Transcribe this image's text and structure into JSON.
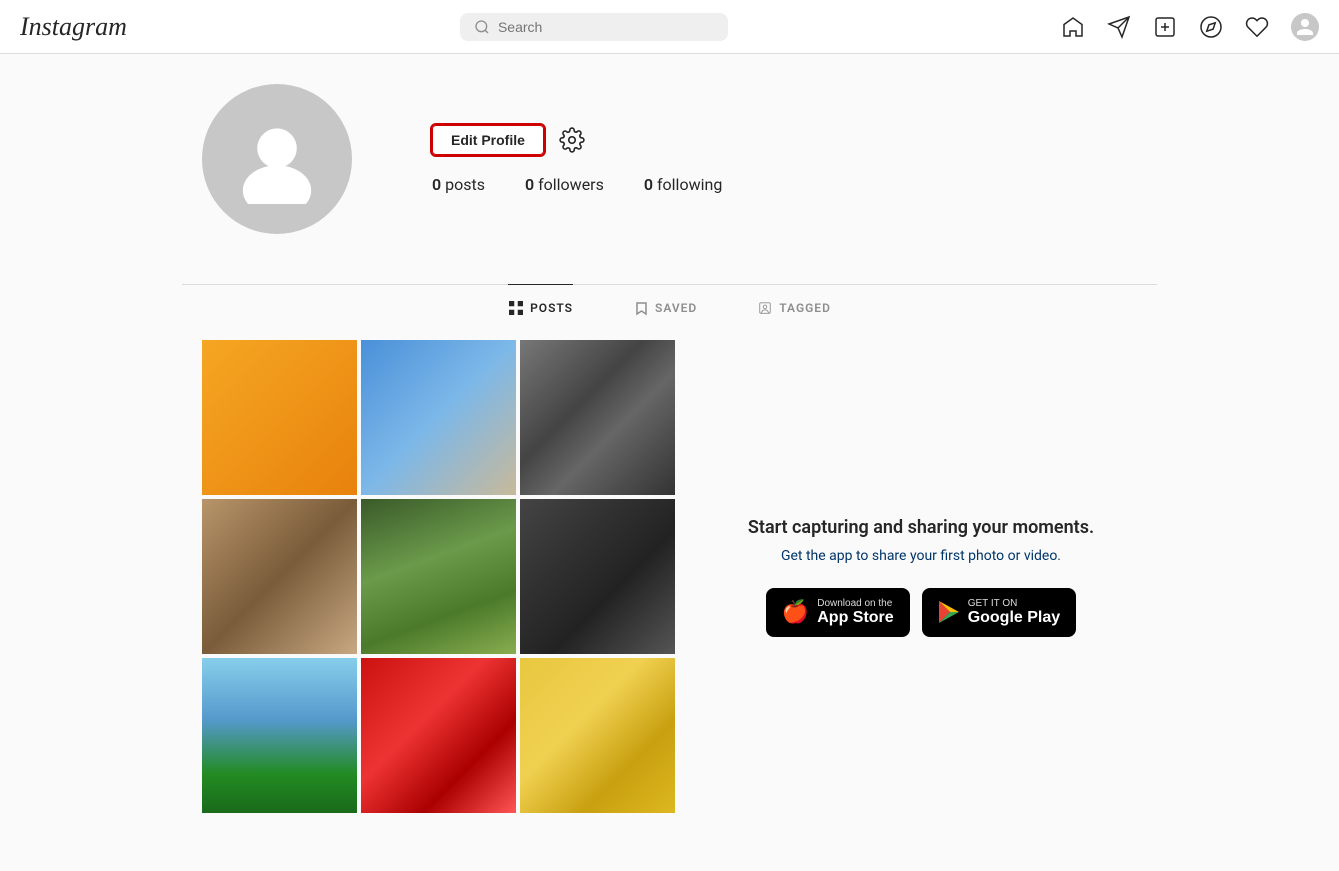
{
  "header": {
    "logo": "Instagram",
    "search_placeholder": "Search",
    "nav_icons": [
      "home-icon",
      "direct-icon",
      "new-post-icon",
      "explore-icon",
      "heart-icon",
      "profile-icon"
    ]
  },
  "profile": {
    "edit_button_label": "Edit Profile",
    "stats": {
      "posts_count": "0",
      "posts_label": "posts",
      "followers_count": "0",
      "followers_label": "followers",
      "following_count": "0",
      "following_label": "following"
    }
  },
  "tabs": [
    {
      "id": "posts",
      "label": "POSTS",
      "active": true
    },
    {
      "id": "saved",
      "label": "SAVED",
      "active": false
    },
    {
      "id": "tagged",
      "label": "TAGGED",
      "active": false
    }
  ],
  "promo": {
    "title": "Start capturing and sharing your moments.",
    "subtitle": "Get the app to share your first photo or video.",
    "app_store_small": "Download on the",
    "app_store_large": "App Store",
    "google_play_small": "GET IT ON",
    "google_play_large": "Google Play"
  }
}
